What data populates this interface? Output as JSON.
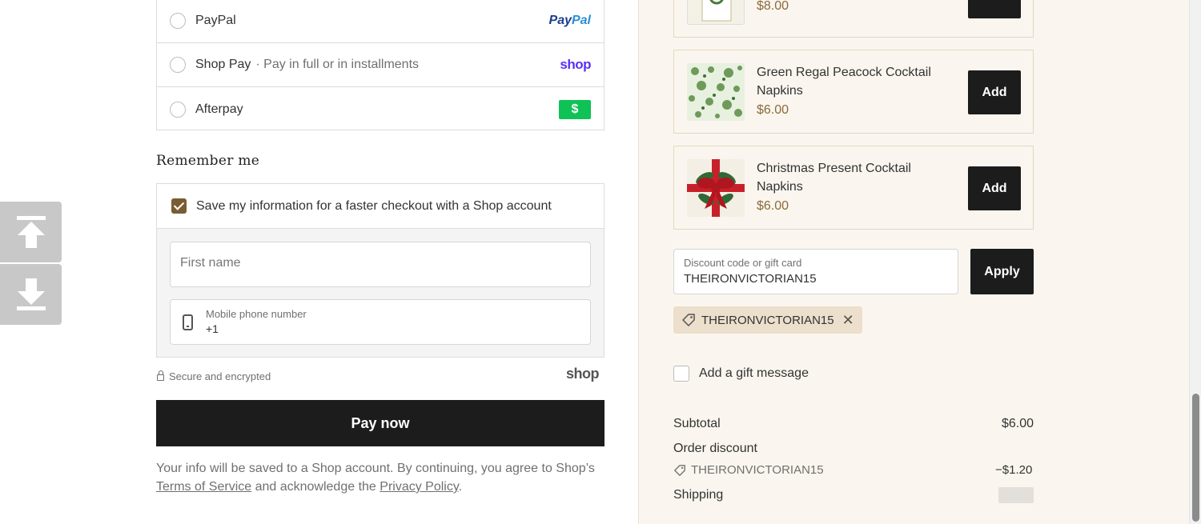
{
  "payment": {
    "methods": [
      {
        "label": "PayPal",
        "sub": "",
        "logo": "paypal-logo"
      },
      {
        "label": "Shop Pay",
        "sub": "· Pay in full or in installments",
        "logo": "shop-pay-logo"
      },
      {
        "label": "Afterpay",
        "sub": "",
        "logo": "afterpay-logo"
      }
    ],
    "paypal_logo_a": "Pay",
    "paypal_logo_b": "Pal",
    "shop_logo": "shop",
    "afterpay_glyph": "$"
  },
  "remember": {
    "title": "Remember me",
    "checkbox_label": "Save my information for a faster checkout with a Shop account",
    "first_name_placeholder": "First name",
    "phone_label": "Mobile phone number",
    "phone_value": "+1",
    "secure_text": "Secure and encrypted",
    "shop_logo": "shop"
  },
  "pay_now_label": "Pay now",
  "legal": {
    "text_1": "Your info will be saved to a Shop account. By continuing, you agree to Shop’s ",
    "terms": "Terms of Service",
    "text_2": " and acknowledge the ",
    "privacy": "Privacy Policy",
    "text_3": "."
  },
  "upsells": [
    {
      "name": "",
      "price": "$8.00"
    },
    {
      "name": "Green Regal Peacock Cocktail Napkins",
      "price": "$6.00",
      "add_label": "Add"
    },
    {
      "name": "Christmas Present Cocktail Napkins",
      "price": "$6.00",
      "add_label": "Add"
    }
  ],
  "discount": {
    "label": "Discount code or gift card",
    "value": "THEIRONVICTORIAN15",
    "apply_label": "Apply",
    "applied_code": "THEIRONVICTORIAN15"
  },
  "gift_message_label": "Add a gift message",
  "summary": {
    "subtotal_label": "Subtotal",
    "subtotal_value": "$6.00",
    "order_discount_label": "Order discount",
    "discount_code": "THEIRONVICTORIAN15",
    "discount_amount": "−$1.20",
    "shipping_label": "Shipping"
  },
  "colors": {
    "accent_brown": "#7a5c32",
    "button_dark": "#1c1c1c",
    "sidebar_bg": "#faf6ef",
    "shop_purple": "#5a31f4",
    "afterpay_green": "#0fc256"
  }
}
